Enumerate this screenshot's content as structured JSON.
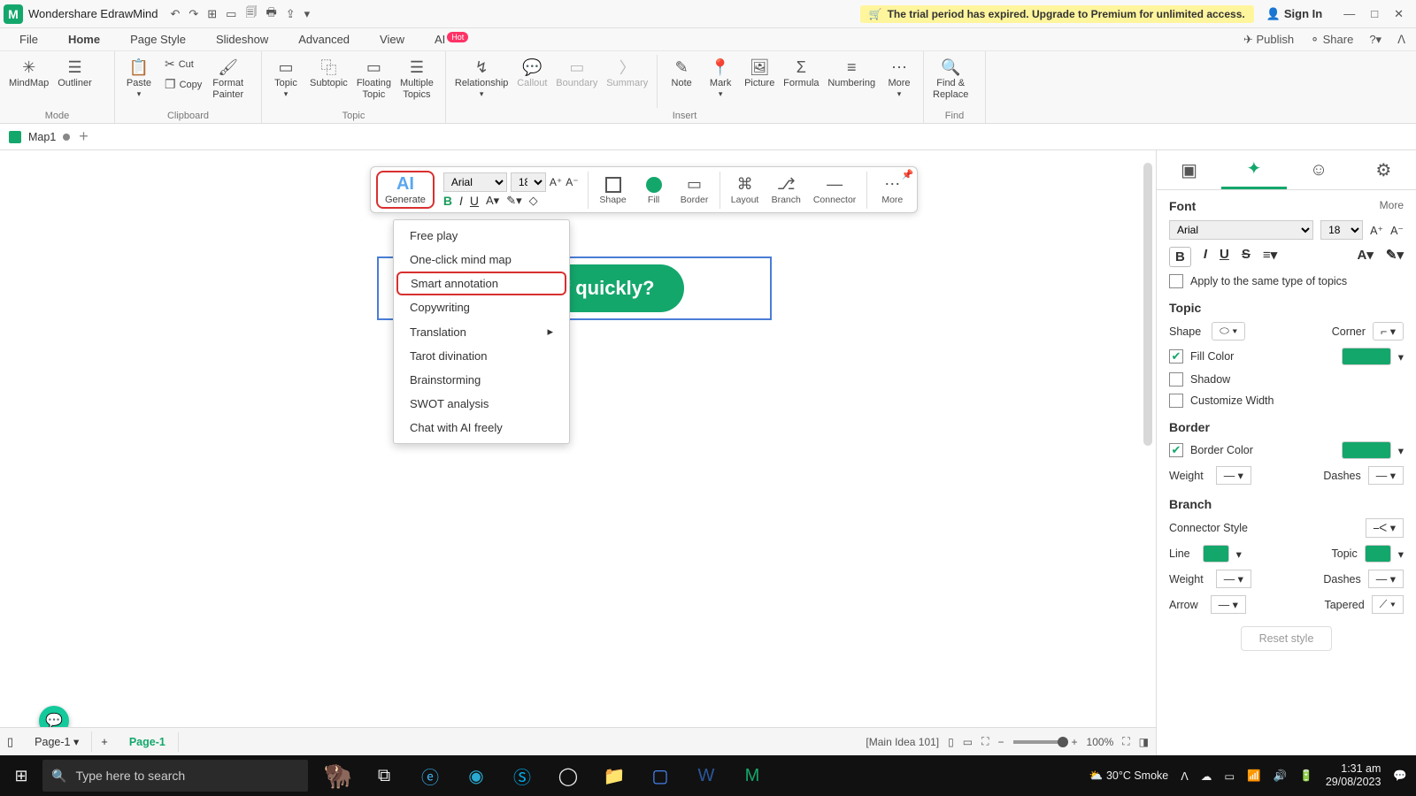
{
  "titlebar": {
    "app_title": "Wondershare EdrawMind",
    "trial_msg": "The trial period has expired. Upgrade to Premium for unlimited access.",
    "signin": "Sign In"
  },
  "tabs": {
    "file": "File",
    "home": "Home",
    "page_style": "Page Style",
    "slideshow": "Slideshow",
    "advanced": "Advanced",
    "view": "View",
    "ai": "AI",
    "hot": "Hot",
    "publish": "Publish",
    "share": "Share"
  },
  "ribbon": {
    "mode": {
      "mindmap": "MindMap",
      "outliner": "Outliner",
      "label": "Mode"
    },
    "clipboard": {
      "paste": "Paste",
      "cut": "Cut",
      "copy": "Copy",
      "format_painter": "Format\nPainter",
      "label": "Clipboard"
    },
    "topic": {
      "topic": "Topic",
      "subtopic": "Subtopic",
      "floating": "Floating\nTopic",
      "multiple": "Multiple\nTopics",
      "label": "Topic"
    },
    "insert": {
      "relationship": "Relationship",
      "callout": "Callout",
      "boundary": "Boundary",
      "summary": "Summary",
      "note": "Note",
      "mark": "Mark",
      "picture": "Picture",
      "formula": "Formula",
      "numbering": "Numbering",
      "more": "More",
      "label": "Insert"
    },
    "find": {
      "findreplace": "Find &\nReplace",
      "label": "Find"
    }
  },
  "doctab": {
    "name": "Map1"
  },
  "floatbar": {
    "generate": "Generate",
    "font": "Arial",
    "size": "18",
    "shape": "Shape",
    "fill": "Fill",
    "border": "Border",
    "layout": "Layout",
    "branch": "Branch",
    "connector": "Connector",
    "more": "More"
  },
  "ai_menu": {
    "free_play": "Free play",
    "one_click": "One-click mind map",
    "smart_annotation": "Smart annotation",
    "copywriting": "Copywriting",
    "translation": "Translation",
    "tarot": "Tarot divination",
    "brainstorming": "Brainstorming",
    "swot": "SWOT analysis",
    "chat": "Chat with AI freely"
  },
  "topic_text": "yourself quickly?",
  "rightpanel": {
    "font": {
      "title": "Font",
      "more": "More",
      "name": "Arial",
      "size": "18",
      "apply": "Apply to the same type of topics"
    },
    "topic": {
      "title": "Topic",
      "shape": "Shape",
      "corner": "Corner",
      "fillcolor": "Fill Color",
      "shadow": "Shadow",
      "custom_width": "Customize Width"
    },
    "border": {
      "title": "Border",
      "bordercolor": "Border Color",
      "weight": "Weight",
      "dashes": "Dashes"
    },
    "branch": {
      "title": "Branch",
      "connector": "Connector Style",
      "line": "Line",
      "topic": "Topic",
      "weight": "Weight",
      "dashes": "Dashes",
      "arrow": "Arrow",
      "tapered": "Tapered"
    },
    "reset": "Reset style"
  },
  "pagebar": {
    "page1a": "Page-1",
    "page1b": "Page-1",
    "status": "[Main Idea 101]",
    "zoom": "100%"
  },
  "taskbar": {
    "search_placeholder": "Type here to search",
    "weather": "30°C  Smoke",
    "time": "1:31 am",
    "date": "29/08/2023"
  }
}
